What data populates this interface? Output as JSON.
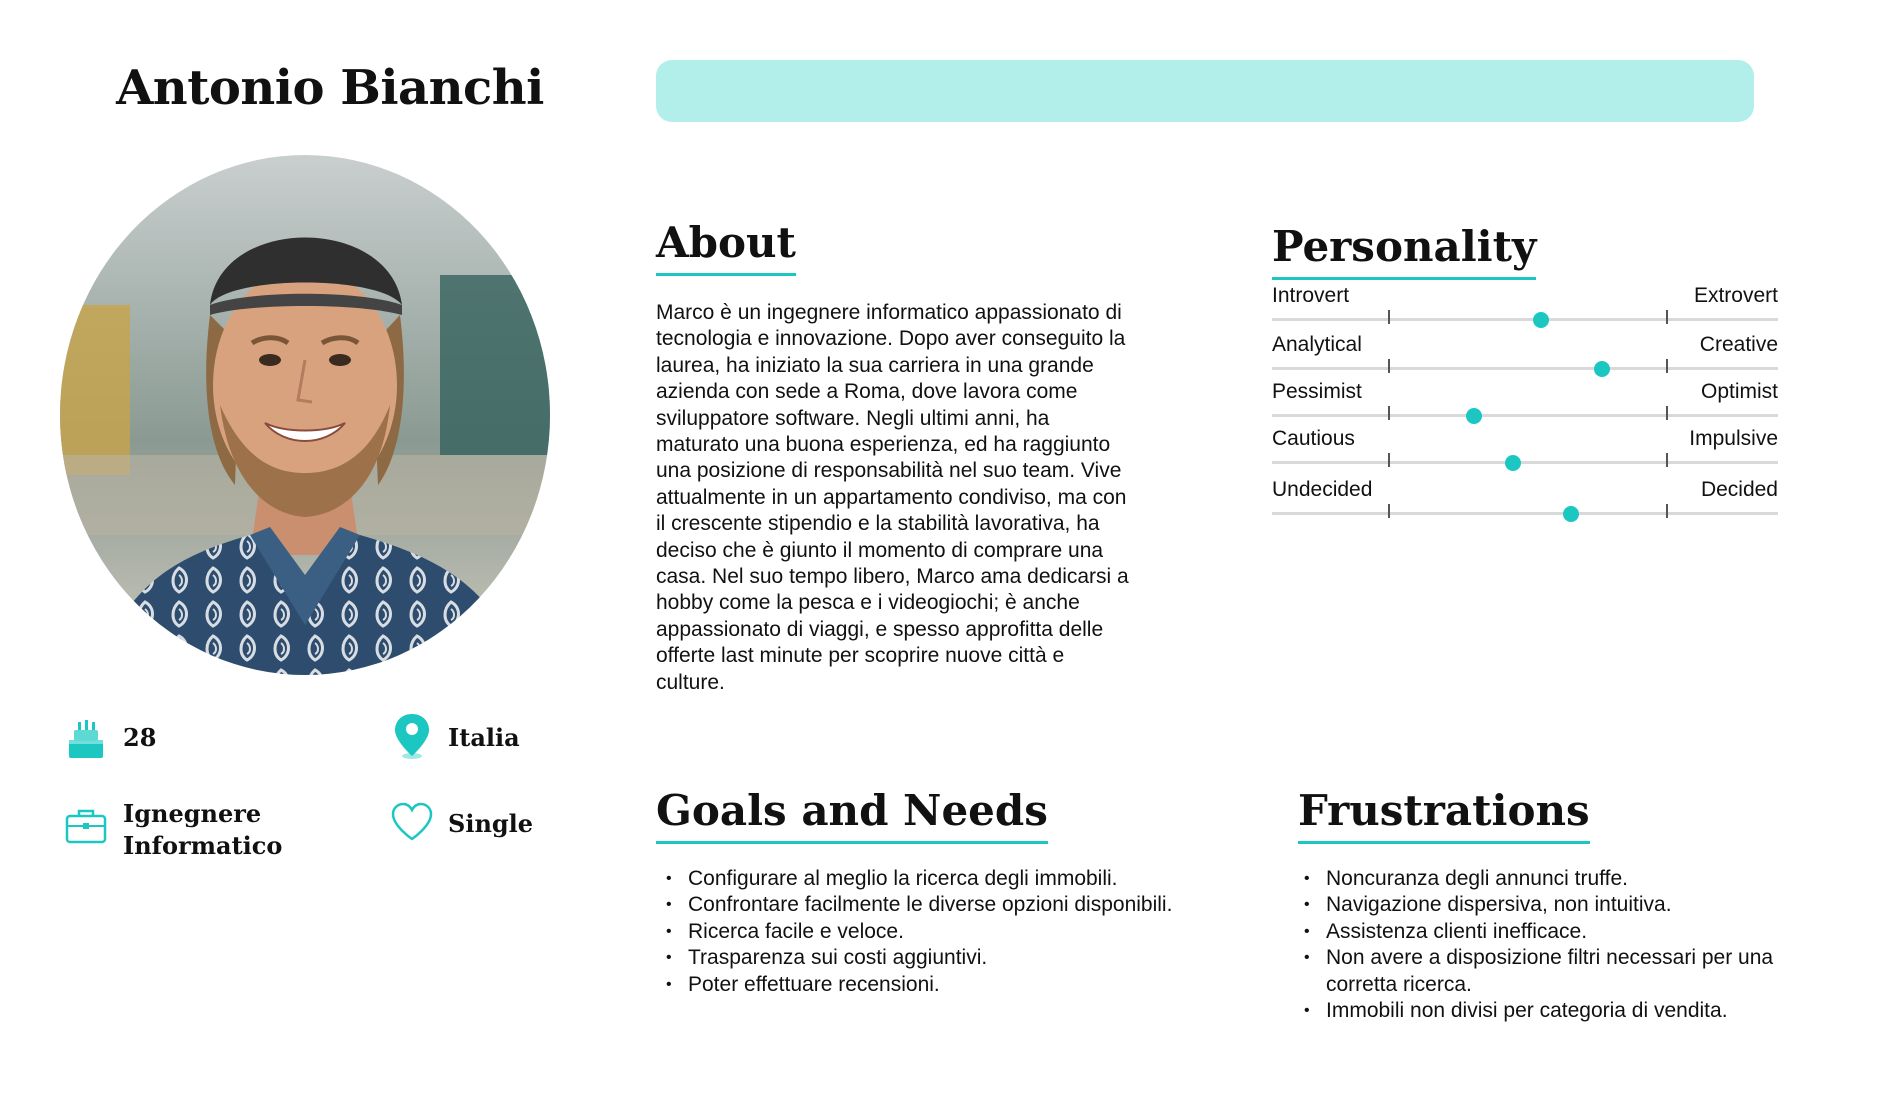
{
  "persona": {
    "name": "Antonio Bianchi",
    "accent_color": "#1cc7c1",
    "banner_color": "#b3efea"
  },
  "info": {
    "age": "28",
    "country": "Italia",
    "job": "Ignegnere Informatico",
    "status": "Single",
    "icons": [
      "cake-icon",
      "map-pin-icon",
      "briefcase-icon",
      "heart-icon"
    ]
  },
  "about": {
    "title": "About",
    "text": "Marco è un ingegnere informatico appassionato di tecnologia e innovazione. Dopo aver conseguito la laurea, ha iniziato la sua carriera in una grande azienda con sede a Roma, dove lavora come sviluppatore software. Negli ultimi anni, ha maturato una buona esperienza, ed ha raggiunto una posizione di responsabilità nel suo team. Vive attualmente in un appartamento condiviso, ma con il crescente stipendio e la stabilità lavorativa, ha deciso che è giunto il momento di comprare una casa. Nel suo tempo libero, Marco ama dedicarsi a hobby come la pesca e i videogiochi; è anche appassionato di viaggi, e spesso approfitta delle offerte last minute per scoprire nuove città e culture."
  },
  "personality": {
    "title": "Personality",
    "traits": [
      {
        "left": "Introvert",
        "right": "Extrovert",
        "value": 0.55
      },
      {
        "left": "Analytical",
        "right": "Creative",
        "value": 0.77
      },
      {
        "left": "Pessimist",
        "right": "Optimist",
        "value": 0.31
      },
      {
        "left": "Cautious",
        "right": "Impulsive",
        "value": 0.45
      },
      {
        "left": "Undecided",
        "right": "Decided",
        "value": 0.66
      }
    ]
  },
  "goals": {
    "title": "Goals and Needs",
    "items": [
      "Configurare al meglio la ricerca degli immobili.",
      "Confrontare facilmente le diverse opzioni disponibili.",
      "Ricerca facile e veloce.",
      "Trasparenza sui costi aggiuntivi.",
      "Poter effettuare recensioni."
    ]
  },
  "frustrations": {
    "title": "Frustrations",
    "items": [
      "Noncuranza degli annunci truffe.",
      "Navigazione dispersiva, non intuitiva.",
      "Assistenza clienti inefficace.",
      "Non avere a disposizione filtri necessari per una corretta ricerca.",
      "Immobili non divisi per categoria di vendita."
    ]
  }
}
